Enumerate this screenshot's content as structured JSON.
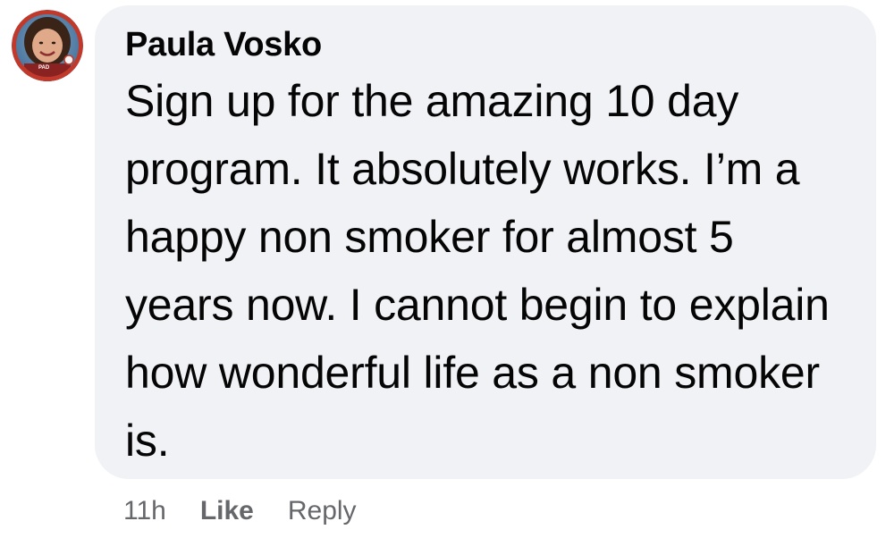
{
  "comment": {
    "author": "Paula Vosko",
    "text": "Sign up for the amazing 10 day program. It absolutely works. I’m a happy non smoker for almost 5 years now. I cannot begin to explain how wonderful life as a non smoker is.",
    "avatar_badge": "PAD",
    "timestamp": "11h",
    "like_label": "Like",
    "reply_label": "Reply"
  },
  "colors": {
    "bubble_bg": "#f0f2f5",
    "text": "#050505",
    "secondary_text": "#65676b",
    "avatar_ring": "#c0392b"
  }
}
